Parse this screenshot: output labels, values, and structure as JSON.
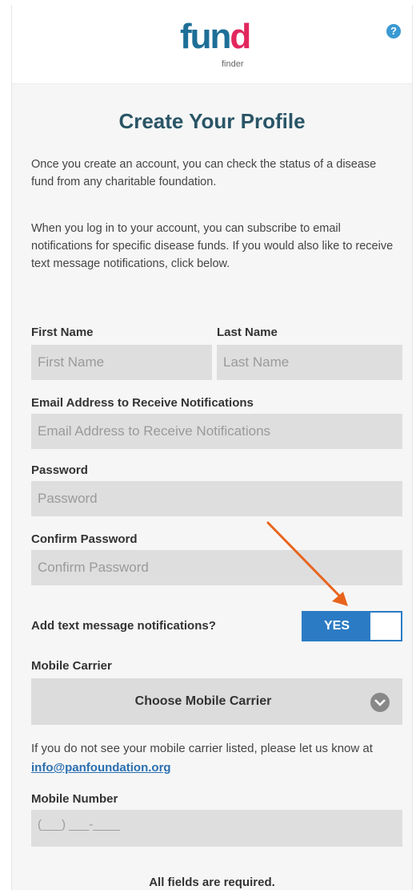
{
  "header": {
    "logo_main": "fund",
    "logo_sub": "finder",
    "help_icon": "question-circle-icon",
    "help_label": "?"
  },
  "title": "Create Your Profile",
  "intro": {
    "p1": "Once you create an account, you can check the status of a disease fund from any charitable foundation.",
    "p2": "When you log in to your account, you can subscribe to email notifications for specific disease funds. If you would also like to receive text message notifications, click below."
  },
  "form": {
    "first_name": {
      "label": "First Name",
      "placeholder": "First Name"
    },
    "last_name": {
      "label": "Last Name",
      "placeholder": "Last Name"
    },
    "email": {
      "label": "Email Address to Receive Notifications",
      "placeholder": "Email Address to Receive Notifications"
    },
    "password": {
      "label": "Password",
      "placeholder": "Password"
    },
    "confirm_password": {
      "label": "Confirm Password",
      "placeholder": "Confirm Password"
    },
    "text_notifications": {
      "label": "Add text message notifications?",
      "toggle_label": "YES",
      "enabled": true
    },
    "carrier": {
      "label": "Mobile Carrier",
      "selected": "Choose Mobile Carrier",
      "icon": "chevron-down-circle-icon"
    },
    "carrier_note": {
      "text": "If you do not see your mobile carrier listed, please let us know at ",
      "email_link": "info@panfoundation.org"
    },
    "mobile": {
      "label": "Mobile Number",
      "mask": "(___) ___-____"
    },
    "footer": "All fields are required."
  },
  "colors": {
    "accent_blue": "#2b7bc4",
    "title_color": "#2a5566",
    "annotation_arrow": "#e8641c",
    "input_bg": "#dedede"
  }
}
